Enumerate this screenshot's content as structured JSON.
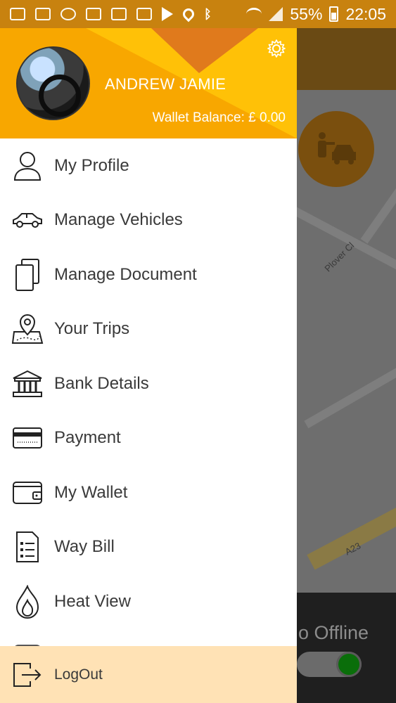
{
  "status_bar": {
    "battery": "55%",
    "time": "22:05",
    "icons": [
      "mail-icon",
      "image-icon",
      "whatsapp-icon",
      "app-icon",
      "bus-icon",
      "bus-icon",
      "play-store-icon",
      "location-icon",
      "bluetooth-icon",
      "wifi-icon",
      "signal-icon",
      "battery-icon"
    ]
  },
  "drawer": {
    "user_name": "ANDREW JAMIE",
    "wallet_balance": "Wallet Balance: £ 0.00",
    "menu": [
      {
        "label": "My Profile",
        "icon": "user-icon"
      },
      {
        "label": "Manage Vehicles",
        "icon": "car-icon"
      },
      {
        "label": "Manage Document",
        "icon": "documents-icon"
      },
      {
        "label": "Your Trips",
        "icon": "map-pin-icon"
      },
      {
        "label": "Bank Details",
        "icon": "bank-icon"
      },
      {
        "label": "Payment",
        "icon": "card-icon"
      },
      {
        "label": "My Wallet",
        "icon": "wallet-icon"
      },
      {
        "label": "Way Bill",
        "icon": "bill-icon"
      },
      {
        "label": "Heat View",
        "icon": "flame-icon"
      }
    ],
    "logout_label": "LogOut"
  },
  "map": {
    "street_1": "Plover Cl",
    "street_2": "A23",
    "status_text": "o Offline"
  },
  "colors": {
    "status_bar": "#c8820f",
    "header": "#f8a700",
    "header_accent": "#ffc107",
    "logout_bg": "#ffe2b5",
    "toggle_on": "#0a6e0a"
  }
}
